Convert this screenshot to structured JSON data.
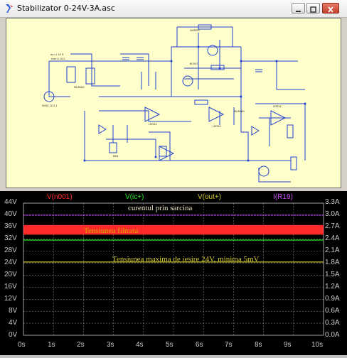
{
  "window": {
    "title": "Stabilizator 0-24V-3A.asc"
  },
  "schematic": {
    "annotations": [
      "ac=1 10 9",
      ".tran 0 10 0",
      "50HZ 10 0.1"
    ],
    "components": [
      "R1",
      "R2",
      "R3",
      "R4",
      "R5",
      "R6",
      "R7",
      "R8",
      "R9",
      "R10",
      "R11",
      "R12",
      "R13",
      "R14",
      "R15",
      "R16",
      "R17",
      "R18",
      "R19",
      "C1",
      "C2",
      "C3",
      "C4",
      "C5",
      "C6",
      "Q1",
      "Q2",
      "Q3",
      "Q4",
      "U1",
      "U2",
      "U3",
      "U4",
      "D1",
      "D2",
      "D3",
      "D4",
      "BZX",
      "MUR460",
      "LM324",
      "BC547",
      "2N3055"
    ]
  },
  "plot": {
    "traces": [
      {
        "name": "V(n001)",
        "color": "#ff2a2a"
      },
      {
        "name": "V(ic+)",
        "color": "#2ee52e"
      },
      {
        "name": "V(out+)",
        "color": "#d2c832"
      },
      {
        "name": "I(R19)",
        "color": "#c64cf0"
      }
    ],
    "left_axis": [
      "44V",
      "40V",
      "36V",
      "32V",
      "28V",
      "24V",
      "20V",
      "16V",
      "12V",
      "8V",
      "4V",
      "0V"
    ],
    "right_axis": [
      "3.3A",
      "3.0A",
      "2.7A",
      "2.4A",
      "2.1A",
      "1.8A",
      "1.5A",
      "1.2A",
      "0.9A",
      "0.6A",
      "0.3A",
      "0.0A"
    ],
    "x_axis": [
      "0s",
      "1s",
      "2s",
      "3s",
      "4s",
      "5s",
      "6s",
      "7s",
      "8s",
      "9s",
      "10s"
    ],
    "annotations": {
      "current": "curentul prin sarcina",
      "filtered": "Tensiunea filtrata",
      "max_out": "Tensiunea maxima de iesire 24V, minima 5mV"
    }
  },
  "chart_data": {
    "type": "line",
    "title": "",
    "xlabel": "",
    "ylabel": "",
    "x": [
      0,
      10
    ],
    "xlim": [
      0,
      10
    ],
    "ylim": [
      0,
      44
    ],
    "y2lim": [
      0,
      3.3
    ],
    "xticks": [
      "0s",
      "1s",
      "2s",
      "3s",
      "4s",
      "5s",
      "6s",
      "7s",
      "8s",
      "9s",
      "10s"
    ],
    "yticks": [
      "0V",
      "4V",
      "8V",
      "12V",
      "16V",
      "20V",
      "24V",
      "28V",
      "32V",
      "36V",
      "40V",
      "44V"
    ],
    "y2ticks": [
      "0.0A",
      "0.3A",
      "0.6A",
      "0.9A",
      "1.2A",
      "1.5A",
      "1.8A",
      "2.1A",
      "2.4A",
      "2.7A",
      "3.0A",
      "3.3A"
    ],
    "grid": true,
    "legend": "top",
    "series": [
      {
        "name": "V(n001)",
        "axis": "left",
        "band": [
          33.5,
          36.7
        ]
      },
      {
        "name": "V(ic+)",
        "axis": "left",
        "values": [
          31.7,
          31.7
        ]
      },
      {
        "name": "V(out+)",
        "axis": "left",
        "values": [
          24.4,
          24.4
        ]
      },
      {
        "name": "I(R19)",
        "axis": "right",
        "values": [
          3.0,
          3.0
        ]
      }
    ]
  }
}
